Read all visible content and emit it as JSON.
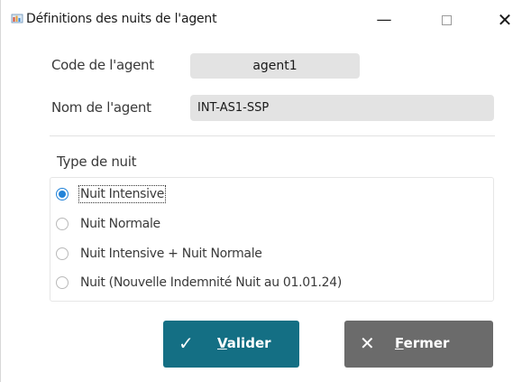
{
  "window": {
    "title": "Définitions des nuits de l'agent",
    "icon": "app-icon",
    "controls": {
      "minimize": "—",
      "close": "✕"
    }
  },
  "form": {
    "code_label": "Code de l'agent",
    "code_value": "agent1",
    "nom_label": "Nom de l'agent",
    "nom_value": "INT-AS1-SSP",
    "type_label": "Type de nuit",
    "options": [
      {
        "label": "Nuit Intensive",
        "checked": true
      },
      {
        "label": "Nuit Normale",
        "checked": false
      },
      {
        "label": "Nuit Intensive + Nuit Normale",
        "checked": false
      },
      {
        "label": "Nuit (Nouvelle Indemnité Nuit au 01.01.24)",
        "checked": false
      }
    ]
  },
  "buttons": {
    "valider": {
      "icon": "✓",
      "underlined": "V",
      "rest": "alider"
    },
    "fermer": {
      "icon": "✕",
      "underlined": "F",
      "rest": "ermer"
    }
  },
  "colors": {
    "valider_bg": "#146f84",
    "fermer_bg": "#6b6b6b",
    "radio_accent": "#2283d8",
    "field_bg": "#e3e3e3"
  }
}
